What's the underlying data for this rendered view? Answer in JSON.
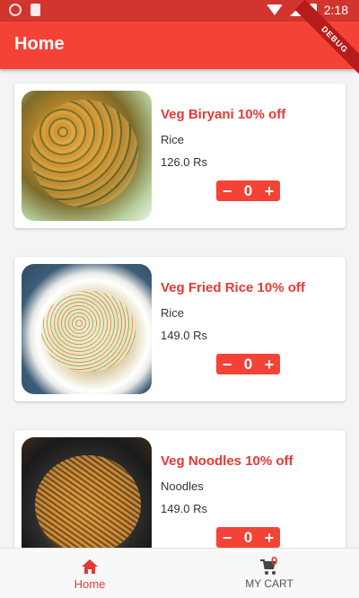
{
  "status_bar": {
    "time": "2:18"
  },
  "app_bar": {
    "title": "Home",
    "debug_banner": "DEBUG"
  },
  "products": [
    {
      "name": "Veg Biryani 10% off",
      "category": "Rice",
      "price": "126.0 Rs",
      "quantity": "0",
      "image": "biryani"
    },
    {
      "name": "Veg Fried Rice 10% off",
      "category": "Rice",
      "price": "149.0 Rs",
      "quantity": "0",
      "image": "friedrice"
    },
    {
      "name": "Veg Noodles 10% off",
      "category": "Noodles",
      "price": "149.0 Rs",
      "quantity": "0",
      "image": "noodles"
    }
  ],
  "stepper": {
    "minus": "−",
    "plus": "+"
  },
  "bottom_nav": {
    "home_label": "Home",
    "cart_label": "MY CART",
    "cart_count": "0"
  },
  "colors": {
    "primary": "#f44336",
    "status_bar": "#d2342e",
    "accent_text": "#e53935"
  }
}
